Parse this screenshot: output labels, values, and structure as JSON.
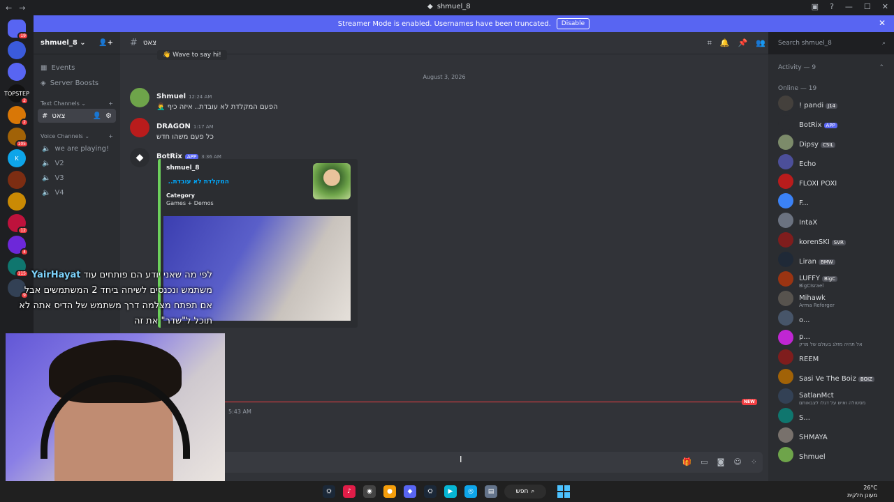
{
  "window": {
    "title": "shmuel_8"
  },
  "banner": {
    "text": "Streamer Mode is enabled. Usernames have been truncated.",
    "disable_label": "Disable"
  },
  "servers": [
    {
      "label": "",
      "badge": "19",
      "color": "#5865f2"
    },
    {
      "label": "",
      "badge": "",
      "color": "#3b5bdb"
    },
    {
      "label": "",
      "badge": "",
      "color": "#5865f2"
    },
    {
      "label": "TOPSTEP",
      "badge": "2",
      "color": "#111111"
    },
    {
      "label": "",
      "badge": "2",
      "color": "#d97706"
    },
    {
      "label": "",
      "badge": "105",
      "color": "#a16207"
    },
    {
      "label": "K",
      "badge": "",
      "color": "#0ea5e9"
    },
    {
      "label": "",
      "badge": "",
      "color": "#7c2d12"
    },
    {
      "label": "",
      "badge": "",
      "color": "#ca8a04"
    },
    {
      "label": "",
      "badge": "12",
      "color": "#be123c"
    },
    {
      "label": "",
      "badge": "4",
      "color": "#6d28d9"
    },
    {
      "label": "",
      "badge": "115",
      "color": "#0f766e"
    },
    {
      "label": "",
      "badge": "9",
      "color": "#334155"
    }
  ],
  "sidebar": {
    "guild_name": "shmuel_8",
    "items": [
      {
        "label": "Events"
      },
      {
        "label": "Server Boosts"
      }
    ],
    "text_category": "Text Channels",
    "text_channels": [
      {
        "label": "צאט"
      }
    ],
    "voice_category": "Voice Channels",
    "voice_channels": [
      {
        "label": "we are playing!"
      },
      {
        "label": "V2"
      },
      {
        "label": "V3"
      },
      {
        "label": "V4"
      }
    ]
  },
  "chat": {
    "channel_name": "צאט",
    "search_placeholder": "Search shmuel_8",
    "wave_text": "Wave to say hi!",
    "date_divider": "August 3, 2026",
    "messages": [
      {
        "author": "Shmuel",
        "time": "12:24 AM",
        "text": "הפעם המקלדת לא עובדת.. איזה כיף 🤦‍♂️",
        "avatar_color": "#6ea44a"
      },
      {
        "author": "DRAGON",
        "time": "1:17 AM",
        "text": "כל פעם משהו חדש",
        "avatar_color": "#b91c1c"
      },
      {
        "author": "BotRix",
        "app_tag": "APP",
        "time": "3:36 AM",
        "avatar_color": "#2b2d31"
      }
    ],
    "embed": {
      "author": "shmuel_8",
      "title": "המקלדת לא עובדת..",
      "field_name": "Category",
      "field_value": "Games + Demos"
    },
    "new_tag": "NEW",
    "late_time": "5:43 AM"
  },
  "members": {
    "activity_label": "Activity — 9",
    "online_label": "Online — 19",
    "list": [
      {
        "name": "! pandi",
        "tag": "J14",
        "sub": "",
        "color": "#44403c"
      },
      {
        "name": "BotRix",
        "tag": "APP",
        "sub": "",
        "color": "#2b2d31"
      },
      {
        "name": "Dipsy",
        "tag": "CSIL",
        "sub": "",
        "color": "#7c8b6a"
      },
      {
        "name": "Echo",
        "tag": "",
        "sub": "",
        "color": "#4c4f9a"
      },
      {
        "name": "FLOXI POXI",
        "tag": "",
        "sub": "",
        "color": "#b91c1c"
      },
      {
        "name": "F...",
        "tag": "",
        "sub": "",
        "color": "#3b82f6"
      },
      {
        "name": "IntaX",
        "tag": "",
        "sub": "",
        "color": "#6b7280"
      },
      {
        "name": "korenSKI",
        "tag": "SVR",
        "sub": "",
        "color": "#7f1d1d"
      },
      {
        "name": "Liran",
        "tag": "BMW",
        "sub": "",
        "color": "#1f2937"
      },
      {
        "name": "LUFFY",
        "tag": "BigC",
        "sub": "BigCIsrael",
        "color": "#9a3412"
      },
      {
        "name": "Mihawk",
        "tag": "",
        "sub": "Arma Reforger",
        "color": "#57534e"
      },
      {
        "name": "o...",
        "tag": "",
        "sub": "",
        "color": "#475569"
      },
      {
        "name": "p...",
        "tag": "",
        "sub": "אל תהיה מזלג בעולם של מרק",
        "color": "#c026d3"
      },
      {
        "name": "REEM",
        "tag": "",
        "sub": "",
        "color": "#7f1d1d"
      },
      {
        "name": "Sasi Ve The Boiz",
        "tag": "BOIZ",
        "sub": "",
        "color": "#a16207"
      },
      {
        "name": "SatlanMct",
        "tag": "",
        "sub": "מסטולה ואיש על דגלו לצבאותם",
        "color": "#334155"
      },
      {
        "name": "S...",
        "tag": "",
        "sub": "",
        "color": "#0f766e"
      },
      {
        "name": "SHMAYA",
        "tag": "",
        "sub": "",
        "color": "#78716c"
      },
      {
        "name": "Shmuel",
        "tag": "",
        "sub": "",
        "color": "#6ea44a"
      }
    ]
  },
  "overlay": {
    "username": "YairHayat",
    "lines": [
      "לפי מה שאני יודע הם פותחים עוד",
      "משתמש ונכנסים לשיחה ביחד 2 המשתמשים אבל",
      "אם תפתח מצלמה דרך משתמש של הדיס אתה לא",
      "תוכל ל\"שדר\" את זה"
    ]
  },
  "taskbar": {
    "search_label": "חפש",
    "weather_temp": "26°C",
    "weather_desc": "מעונן חלקית"
  }
}
